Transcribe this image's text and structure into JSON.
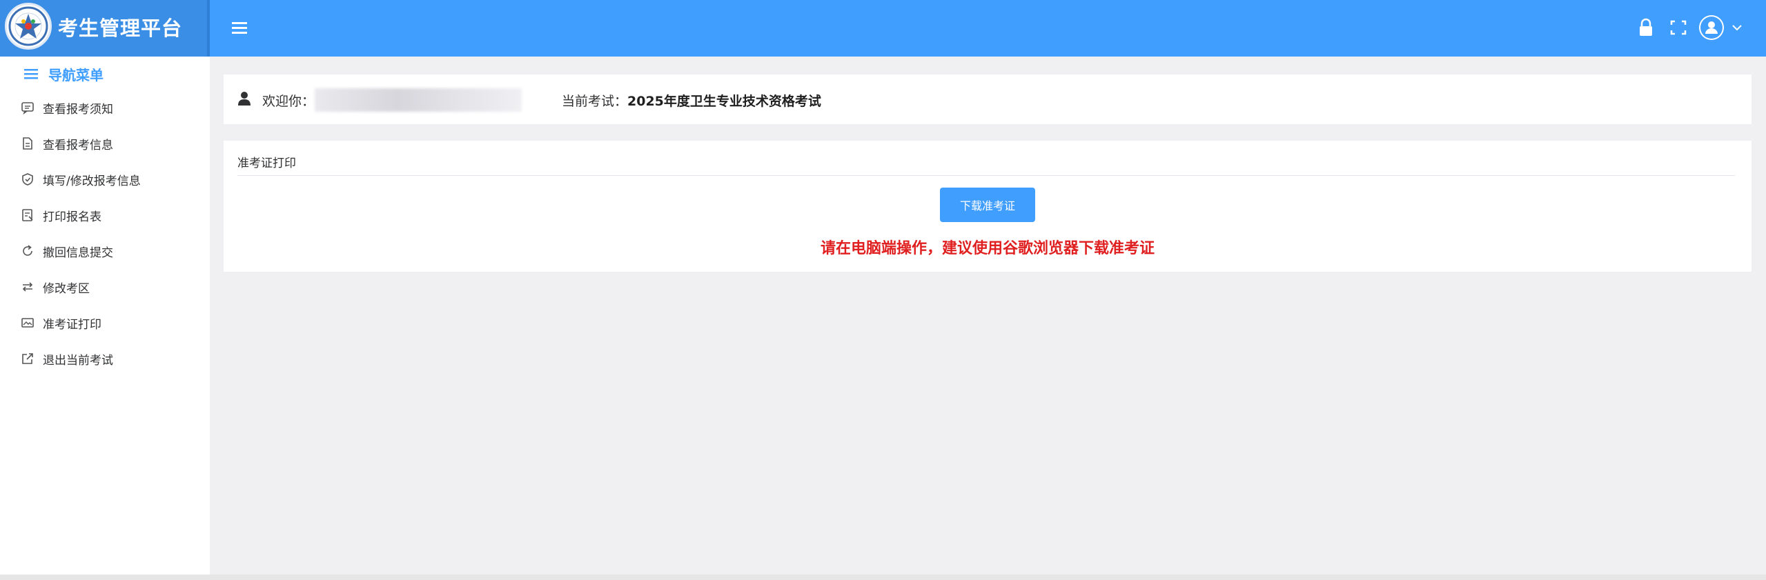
{
  "app": {
    "title": "考生管理平台"
  },
  "sidebar": {
    "header": "导航菜单",
    "items": [
      {
        "label": "查看报考须知",
        "icon": "message-icon"
      },
      {
        "label": "查看报考信息",
        "icon": "document-icon"
      },
      {
        "label": "填写/修改报考信息",
        "icon": "shield-check-icon"
      },
      {
        "label": "打印报名表",
        "icon": "print-form-icon"
      },
      {
        "label": "撤回信息提交",
        "icon": "refresh-icon"
      },
      {
        "label": "修改考区",
        "icon": "switch-icon"
      },
      {
        "label": "准考证打印",
        "icon": "ticket-icon"
      },
      {
        "label": "退出当前考试",
        "icon": "exit-icon"
      }
    ]
  },
  "welcome": {
    "label": "欢迎你：",
    "exam_label": "当前考试：",
    "exam_name": "2025年度卫生专业技术资格考试"
  },
  "print_card": {
    "title": "准考证打印",
    "download_label": "下载准考证",
    "warning": "请在电脑端操作，建议使用谷歌浏览器下载准考证"
  },
  "colors": {
    "primary": "#409eff",
    "warning": "#e02020",
    "background": "#f0f0f3"
  }
}
